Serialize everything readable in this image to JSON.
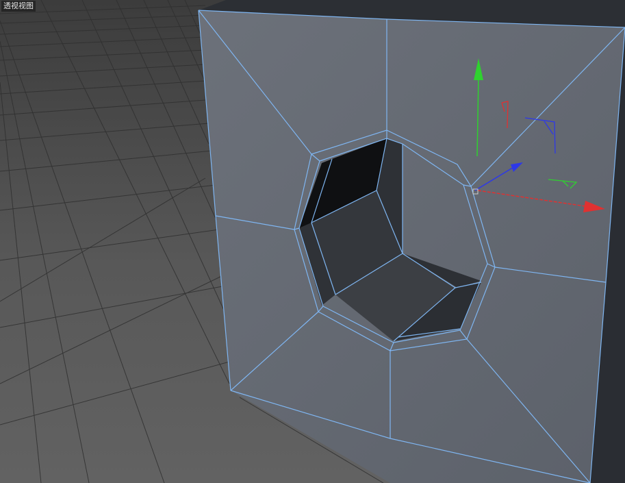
{
  "viewport": {
    "label": "透视视图",
    "colors": {
      "background_top": "#3b3b3b",
      "background_bottom": "#5f5f5f",
      "grid_line": "#343434",
      "mesh_face_light": "#6e737c",
      "mesh_face_mid": "#616670",
      "mesh_face_dark": "#2a2d33",
      "hole_interior_dark": "#111214",
      "hole_interior_mid": "#3a3d42",
      "edge_highlight": "#7fb6f2",
      "axis_x": "#e03131",
      "axis_y": "#2fd12f",
      "axis_z": "#2d38e8"
    },
    "object": {
      "type": "cube-with-hole",
      "selected": true
    },
    "gizmo": {
      "type": "move-tool",
      "axes": [
        "x-axis",
        "y-axis",
        "z-axis"
      ]
    }
  }
}
